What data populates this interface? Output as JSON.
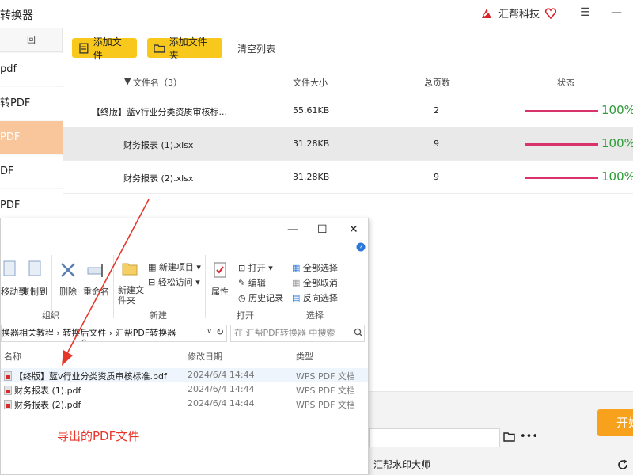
{
  "app": {
    "title": "转换器",
    "brand": "汇帮科技"
  },
  "sidebar": {
    "top_label": "回",
    "items": [
      {
        "label": "pdf"
      },
      {
        "label": "转PDF"
      },
      {
        "label": "PDF"
      },
      {
        "label": "DF"
      },
      {
        "label": "PDF"
      }
    ]
  },
  "toolbar": {
    "add_file": "添加文件",
    "add_folder": "添加文件夹",
    "clear_list": "清空列表"
  },
  "table": {
    "columns": {
      "name": "文件名（3）",
      "size": "文件大小",
      "pages": "总页数",
      "status": "状态"
    },
    "rows": [
      {
        "name": "【终版】蓝v行业分类资质审核标...",
        "size": "55.61KB",
        "pages": "2",
        "progress": 1.0,
        "status": "100%"
      },
      {
        "name": "财务报表 (1).xlsx",
        "size": "31.28KB",
        "pages": "9",
        "progress": 1.0,
        "status": "100%"
      },
      {
        "name": "财务报表 (2).xlsx",
        "size": "31.28KB",
        "pages": "9",
        "progress": 1.0,
        "status": "100%"
      }
    ]
  },
  "bottom": {
    "start": "开始",
    "footer": "汇帮水印大师"
  },
  "explorer": {
    "ribbon": {
      "move_to": "移动到",
      "copy_to": "复制到",
      "delete": "删除",
      "rename": "重命名",
      "new_folder": "新建文件夹",
      "new_item": "新建项目",
      "easy_access": "轻松访问",
      "properties": "属性",
      "open": "打开",
      "edit": "编辑",
      "history": "历史记录",
      "select_all": "全部选择",
      "select_none": "全部取消",
      "invert": "反向选择",
      "group_organize": "组织",
      "group_new": "新建",
      "group_open": "打开",
      "group_select": "选择"
    },
    "address": "换器相关教程 › 转换后文件 › 汇帮PDF转换器",
    "search_placeholder": "在 汇帮PDF转换器 中搜索",
    "columns": {
      "name": "名称",
      "date": "修改日期",
      "type": "类型"
    },
    "files": [
      {
        "name": "【终版】蓝v行业分类资质审核标准.pdf",
        "date": "2024/6/4 14:44",
        "type": "WPS PDF 文档"
      },
      {
        "name": "财务报表 (1).pdf",
        "date": "2024/6/4 14:44",
        "type": "WPS PDF 文档"
      },
      {
        "name": "财务报表 (2).pdf",
        "date": "2024/6/4 14:44",
        "type": "WPS PDF 文档"
      }
    ]
  },
  "annotation": "导出的PDF文件",
  "colors": {
    "accent_yellow": "#f8c81c",
    "active_sidebar": "#f9c59a",
    "progress": "#d8336b",
    "done_text": "#2e9c38",
    "annotation": "#e8362b",
    "start_button": "#f8a11c"
  }
}
